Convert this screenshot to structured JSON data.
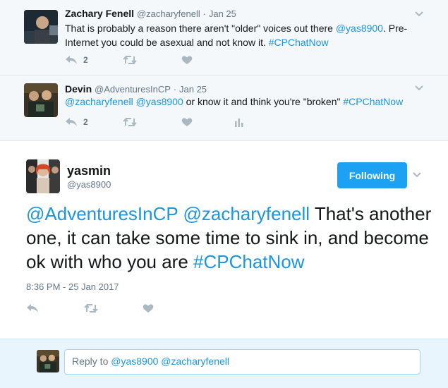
{
  "tweets": [
    {
      "name": "Zachary Fenell",
      "handle": "@zacharyfenell",
      "date": "Jan 25",
      "text_parts": [
        {
          "text": "That is probably a reason there aren't \"older\" voices out there ",
          "link": false
        },
        {
          "text": "@yas8900",
          "link": true
        },
        {
          "text": ". Pre-Internet you could be asexual and not know it. ",
          "link": false
        },
        {
          "text": "#CPChatNow",
          "link": true
        }
      ],
      "reply_count": "2"
    },
    {
      "name": "Devin",
      "handle": "@AdventuresInCP",
      "date": "Jan 25",
      "text_parts": [
        {
          "text": "@zacharyfenell",
          "link": true
        },
        {
          "text": " ",
          "link": false
        },
        {
          "text": "@yas8900",
          "link": true
        },
        {
          "text": " or know it and think you're \"broken\" ",
          "link": false
        },
        {
          "text": "#CPChatNow",
          "link": true
        }
      ],
      "reply_count": "2"
    }
  ],
  "main_tweet": {
    "name": "yasmin",
    "handle": "@yas8900",
    "follow_label": "Following",
    "text_parts": [
      {
        "text": "@AdventuresInCP",
        "link": true
      },
      {
        "text": " ",
        "link": false
      },
      {
        "text": "@zacharyfenell",
        "link": true
      },
      {
        "text": " That's another one, it can take some time to sink in, and become ok with who you are ",
        "link": false
      },
      {
        "text": "#CPChatNow",
        "link": true
      }
    ],
    "timestamp": "8:36 PM - 25 Jan 2017"
  },
  "reply": {
    "placeholder_prefix": "Reply to ",
    "mentions": "@yas8900 @zacharyfenell"
  },
  "colors": {
    "link": "#1b95e0",
    "follow_button": "#1da1f2",
    "icon": "#aab8c2"
  },
  "icons": [
    "reply-icon",
    "retweet-icon",
    "like-icon",
    "analytics-icon",
    "chevron-down-icon"
  ]
}
